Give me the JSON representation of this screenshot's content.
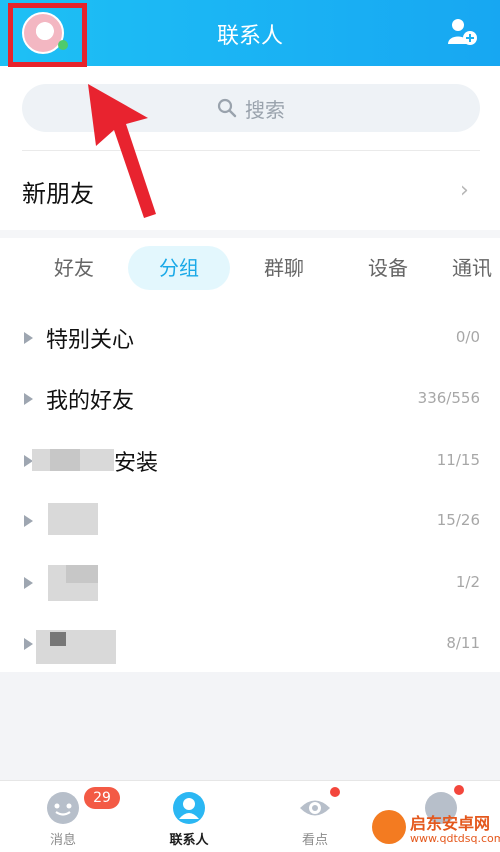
{
  "header": {
    "title": "联系人",
    "avatar_icon": "user-avatar",
    "add_icon": "add-friend-icon",
    "bg_color": "#1ab2f3"
  },
  "search": {
    "placeholder": "搜索",
    "icon": "search-icon"
  },
  "new_friend": {
    "label": "新朋友",
    "chevron": "›"
  },
  "tabs": [
    {
      "label": "好友",
      "active": false
    },
    {
      "label": "分组",
      "active": true
    },
    {
      "label": "群聊",
      "active": false
    },
    {
      "label": "设备",
      "active": false
    },
    {
      "label": "通讯",
      "active": false
    }
  ],
  "groups": [
    {
      "name": "特别关心",
      "count": "0/0"
    },
    {
      "name": "我的好友",
      "count": "336/556"
    },
    {
      "name": "安装",
      "count": "11/15"
    },
    {
      "name": "",
      "count": "15/26"
    },
    {
      "name": "",
      "count": "1/2"
    },
    {
      "name": "",
      "count": "8/11"
    }
  ],
  "bottom_nav": [
    {
      "label": "消息",
      "icon": "message-icon",
      "badge": "29",
      "active": false
    },
    {
      "label": "联系人",
      "icon": "contacts-icon",
      "active": true
    },
    {
      "label": "看点",
      "icon": "eye-icon",
      "active": false
    },
    {
      "label": "",
      "icon": "dynamic-icon",
      "active": false
    }
  ],
  "watermark": {
    "line1": "启东安卓网",
    "line2": "www.qdtdsq.com"
  },
  "colors": {
    "accent": "#1aa9e7",
    "highlight": "#e6232b",
    "badge": "#f35a45"
  }
}
